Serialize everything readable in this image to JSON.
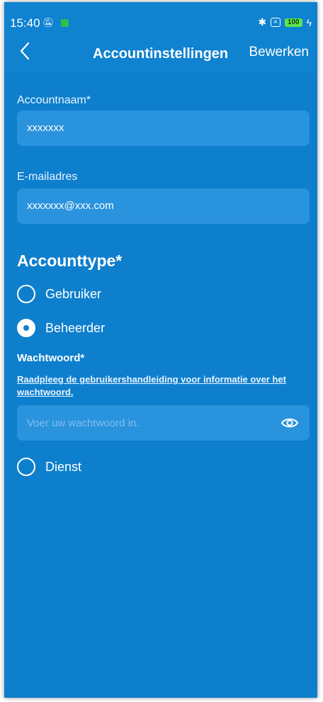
{
  "status_bar": {
    "time": "15:40",
    "right_icons_text": "✱",
    "sim_text": "×",
    "battery": "100",
    "charging": "ϟ"
  },
  "app_bar": {
    "title": "Accountinstellingen",
    "edit_label": "Bewerken"
  },
  "account_name": {
    "label": "Accountnaam*",
    "value": "xxxxxxx"
  },
  "email": {
    "label": "E-mailadres",
    "value": "xxxxxxx@xxx.com"
  },
  "account_type": {
    "title": "Accounttype*",
    "options": [
      {
        "label": "Gebruiker",
        "selected": false
      },
      {
        "label": "Beheerder",
        "selected": true
      },
      {
        "label": "Dienst",
        "selected": false
      }
    ]
  },
  "password": {
    "label": "Wachtwoord*",
    "help_link": "Raadpleeg de gebruikershandleiding voor informatie over het wachtwoord.",
    "placeholder": "Voer uw wachtwoord in."
  },
  "colors": {
    "background": "#0e7fcc",
    "field": "#2a93dd"
  }
}
